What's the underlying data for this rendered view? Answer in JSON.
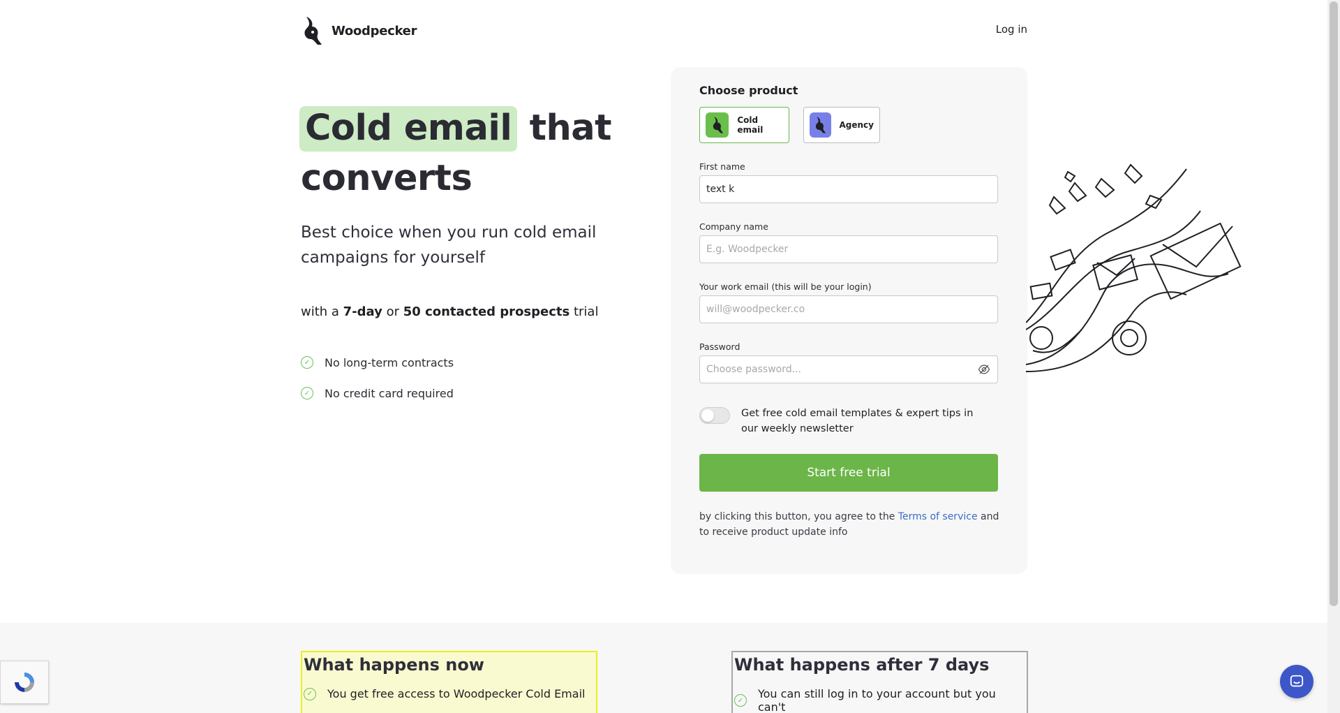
{
  "header": {
    "brand": "Woodpecker",
    "login_label": "Log in"
  },
  "hero": {
    "title_highlight": "Cold email",
    "title_rest_1": " that",
    "title_rest_2": "converts",
    "subtitle": "Best choice when you run cold email campaigns for yourself",
    "trial_prefix": "with a ",
    "trial_days": "7-day",
    "trial_or": " or ",
    "trial_prospects": "50 contacted prospects",
    "trial_suffix": " trial",
    "benefits": [
      "No long-term contracts",
      "No credit card required"
    ]
  },
  "form": {
    "title": "Choose product",
    "products": [
      {
        "label": "Cold email",
        "selected": true
      },
      {
        "label": "Agency",
        "selected": false
      }
    ],
    "first_name": {
      "label": "First name",
      "value": "text k",
      "placeholder": ""
    },
    "company_name": {
      "label": "Company name",
      "value": "",
      "placeholder": "E.g. Woodpecker"
    },
    "work_email": {
      "label": "Your work email (this will be your login)",
      "value": "",
      "placeholder": "will@woodpecker.co"
    },
    "password": {
      "label": "Password",
      "value": "",
      "placeholder": "Choose password..."
    },
    "newsletter": {
      "text": "Get free cold email templates & expert tips in our weekly newsletter",
      "enabled": false
    },
    "submit_label": "Start free trial",
    "legal_prefix": "by clicking this button, you agree to the ",
    "legal_link": "Terms of service",
    "legal_suffix": " and to receive product update info"
  },
  "bottom": {
    "now_title": "What happens now",
    "now_item": "You get free access to Woodpecker Cold Email",
    "after_title": "What happens after 7 days",
    "after_item": "You can still log in to your account but you can't"
  },
  "colors": {
    "accent_green": "#6cb549",
    "highlight": "#cdebc4",
    "agency_blue": "#7880e8",
    "link_blue": "#3b6cc8"
  },
  "icons": {
    "logo": "woodpecker-bird-icon",
    "benefit": "check-circle-icon",
    "password_toggle": "eye-off-icon",
    "chat": "chat-bubble-icon",
    "recaptcha": "recaptcha-icon"
  }
}
